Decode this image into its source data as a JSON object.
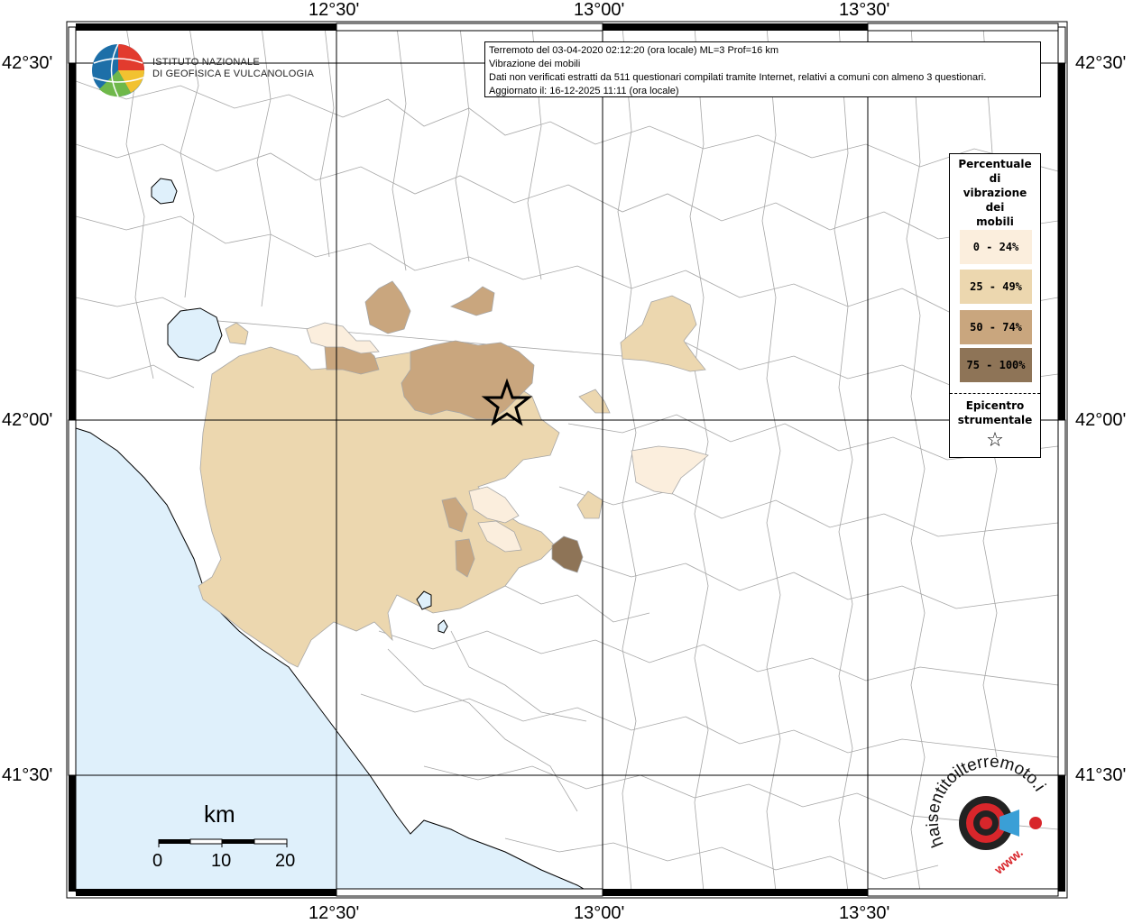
{
  "colors": {
    "sea": "#dff0fb",
    "lake": "#dff0fb",
    "class_0_24": "#fbeedd",
    "class_25_49": "#ecd7af",
    "class_50_74": "#c9a67e",
    "class_75_100": "#8e7457",
    "border": "#a6a6a6"
  },
  "axes": {
    "top_labels": [
      "12°30'",
      "13°00'",
      "13°30'"
    ],
    "bottom_labels": [
      "12°30'",
      "13°00'",
      "13°30'"
    ],
    "left_labels": [
      "42°30'",
      "42°00'",
      "41°30'"
    ],
    "right_labels": [
      "42°30'",
      "42°00'",
      "41°30'"
    ]
  },
  "info": {
    "line1": "Terremoto del 03-04-2020 02:12:20 (ora locale) ML=3 Prof=16 km",
    "line2": "Vibrazione dei mobili",
    "line3": "Dati non verificati estratti da 511 questionari compilati tramite Internet, relativi a comuni con almeno 3 questionari.",
    "line4": "Aggiornato il: 16-12-2025 11:11 (ora locale)"
  },
  "logo": {
    "line1": "ISTITUTO NAZIONALE",
    "line2": "DI GEOFISICA E VULCANOLOGIA",
    "icon": "ingv-globe-icon"
  },
  "legend": {
    "title": [
      "Percentuale",
      "di",
      "vibrazione",
      "dei",
      "mobili"
    ],
    "classes": [
      "0 - 24%",
      "25 - 49%",
      "50 - 74%",
      "75 - 100%"
    ],
    "epicentro": [
      "Epicentro",
      "strumentale"
    ],
    "epicentro_symbol": "☆"
  },
  "scalebar": {
    "unit": "km",
    "labels": [
      "0",
      "10",
      "20"
    ]
  },
  "hsh": {
    "text": "haisentitoilterremoto.it",
    "prefix": "www.",
    "icon": "megaphone-target-icon"
  }
}
